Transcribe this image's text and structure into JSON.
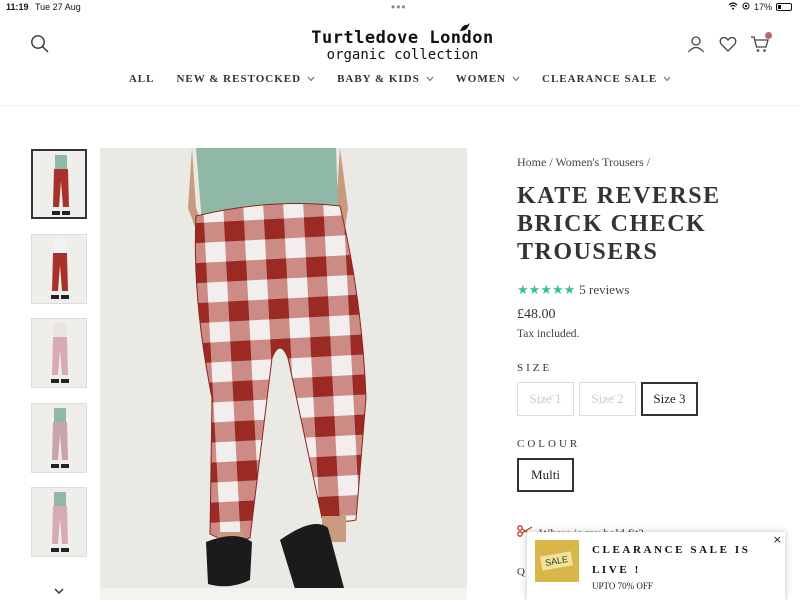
{
  "status_bar": {
    "time": "11:19",
    "date": "Tue 27 Aug",
    "battery": "17%"
  },
  "header": {
    "logo_line1": "Turtledove London",
    "logo_line2": "organic collection",
    "nav": [
      {
        "label": "ALL",
        "has_dropdown": false
      },
      {
        "label": "NEW & RESTOCKED",
        "has_dropdown": true
      },
      {
        "label": "BABY & KIDS",
        "has_dropdown": true
      },
      {
        "label": "WOMEN",
        "has_dropdown": true
      },
      {
        "label": "CLEARANCE SALE",
        "has_dropdown": true
      }
    ]
  },
  "product": {
    "breadcrumb": "Home / Women's Trousers /",
    "title_lines": [
      "KATE REVERSE",
      "BRICK CHECK",
      "TROUSERS"
    ],
    "rating_stars": 5,
    "reviews": "5 reviews",
    "price": "£48.00",
    "tax": "Tax included.",
    "size_label": "SIZE",
    "sizes": [
      "Size 1",
      "Size 2",
      "Size 3"
    ],
    "selected_size": "Size 3",
    "colour_label": "COLOUR",
    "colours": [
      "Multi"
    ],
    "help_text": "Where is my bold fit?",
    "qty_label": "Q"
  },
  "popup": {
    "badge": "SALE",
    "title_line1": "CLEARANCE SALE IS",
    "title_line2": "LIVE !",
    "subtitle": "UPTO 70% OFF",
    "close": "×"
  },
  "colors": {
    "accent_stars": "#3bc18d",
    "check_red": "#a8322b",
    "shirt": "#8fb8a6"
  }
}
